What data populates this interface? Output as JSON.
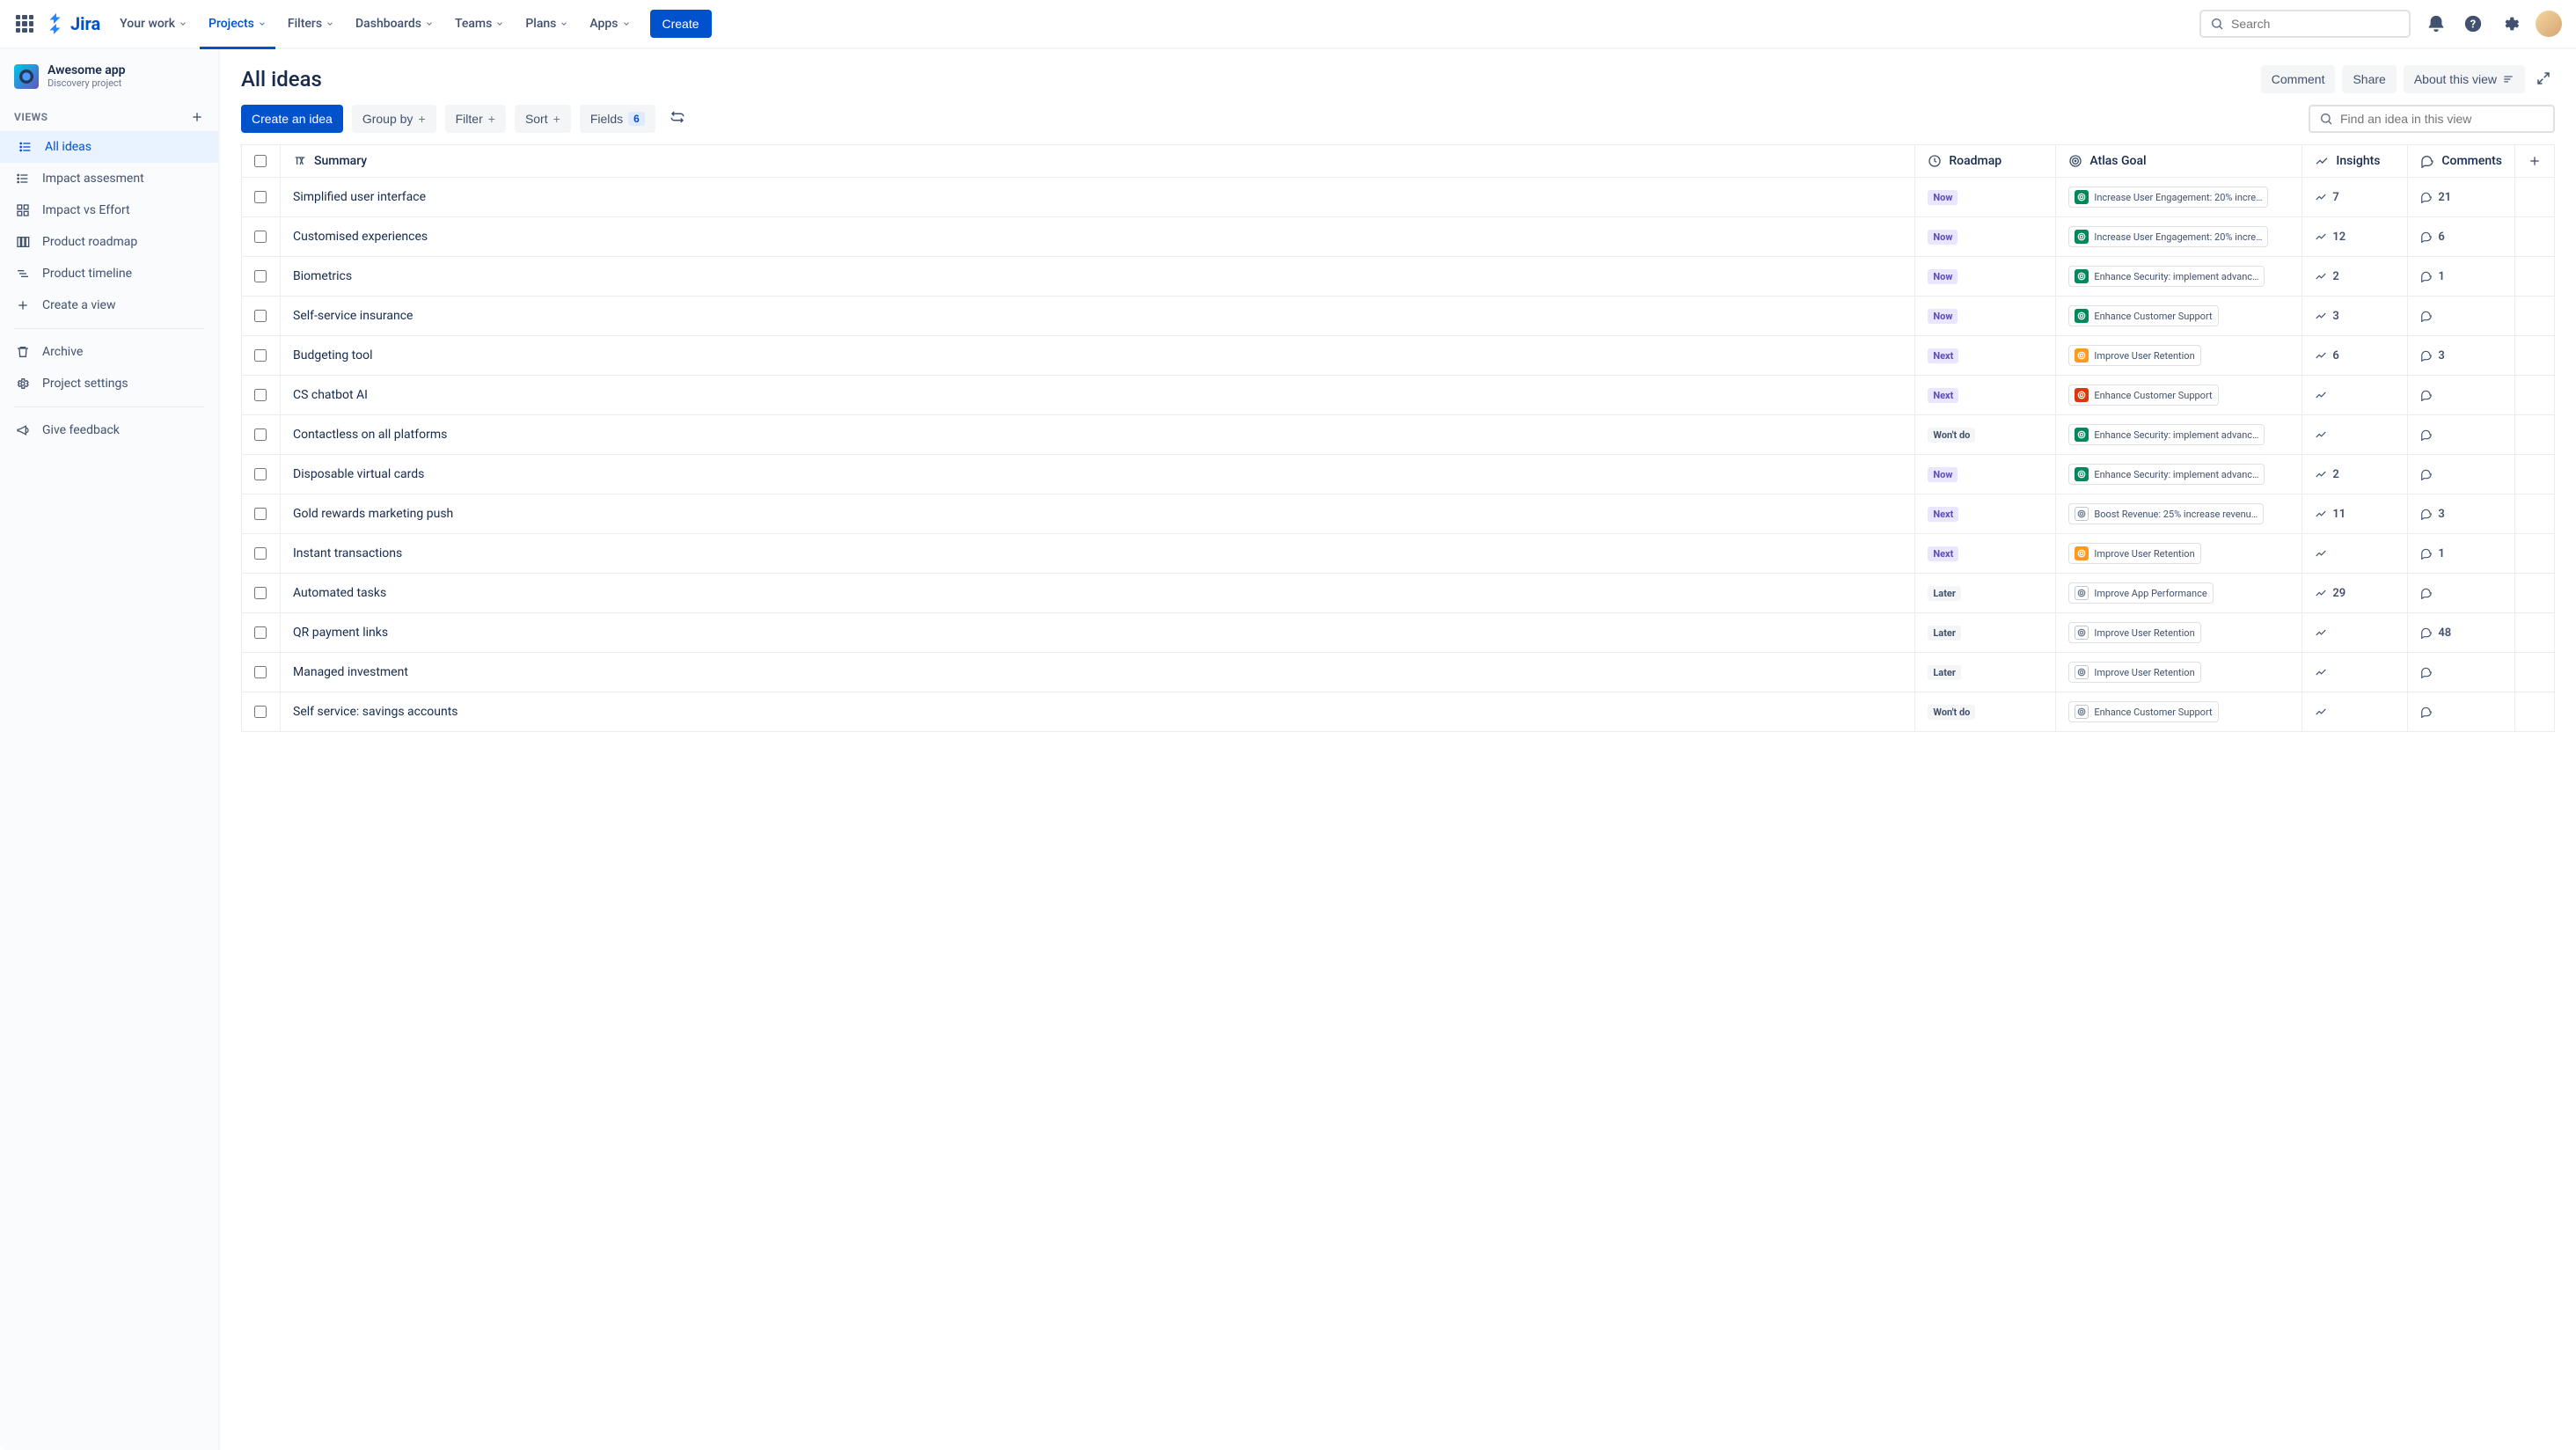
{
  "topnav": {
    "logo": "Jira",
    "items": [
      "Your work",
      "Projects",
      "Filters",
      "Dashboards",
      "Teams",
      "Plans",
      "Apps"
    ],
    "active_index": 1,
    "create": "Create",
    "search_placeholder": "Search"
  },
  "project": {
    "name": "Awesome app",
    "subtitle": "Discovery project"
  },
  "sidebar": {
    "views_label": "VIEWS",
    "items": [
      {
        "label": "All ideas",
        "icon": "list",
        "active": true
      },
      {
        "label": "Impact assesment",
        "icon": "list"
      },
      {
        "label": "Impact vs Effort",
        "icon": "matrix"
      },
      {
        "label": "Product roadmap",
        "icon": "board"
      },
      {
        "label": "Product timeline",
        "icon": "timeline"
      },
      {
        "label": "Create a view",
        "icon": "plus"
      }
    ],
    "archive": "Archive",
    "settings": "Project settings",
    "feedback": "Give feedback"
  },
  "main": {
    "title": "All ideas",
    "header_buttons": {
      "comment": "Comment",
      "share": "Share",
      "about": "About this view"
    },
    "toolbar": {
      "create": "Create an idea",
      "group_by": "Group by",
      "filter": "Filter",
      "sort": "Sort",
      "fields": "Fields",
      "fields_count": "6",
      "find_placeholder": "Find an idea in this view"
    },
    "columns": {
      "summary": "Summary",
      "roadmap": "Roadmap",
      "goal": "Atlas Goal",
      "insights": "Insights",
      "comments": "Comments"
    },
    "rows": [
      {
        "summary": "Simplified user interface",
        "roadmap": "Now",
        "goal": "Increase User Engagement: 20% incre…",
        "goal_status": "green",
        "insights": "7",
        "comments": "21"
      },
      {
        "summary": "Customised experiences",
        "roadmap": "Now",
        "goal": "Increase User Engagement: 20% incre…",
        "goal_status": "green",
        "insights": "12",
        "comments": "6"
      },
      {
        "summary": "Biometrics",
        "roadmap": "Now",
        "goal": "Enhance Security: implement advanc…",
        "goal_status": "green",
        "insights": "2",
        "comments": "1"
      },
      {
        "summary": "Self-service insurance",
        "roadmap": "Now",
        "goal": "Enhance Customer Support",
        "goal_status": "green",
        "insights": "3",
        "comments": ""
      },
      {
        "summary": "Budgeting tool",
        "roadmap": "Next",
        "goal": "Improve User Retention",
        "goal_status": "orange",
        "insights": "6",
        "comments": "3"
      },
      {
        "summary": "CS chatbot AI",
        "roadmap": "Next",
        "goal": "Enhance Customer Support",
        "goal_status": "red",
        "insights": "",
        "comments": ""
      },
      {
        "summary": "Contactless on all platforms",
        "roadmap": "Won't do",
        "goal": "Enhance Security: implement advanc…",
        "goal_status": "green",
        "insights": "",
        "comments": ""
      },
      {
        "summary": "Disposable virtual cards",
        "roadmap": "Now",
        "goal": "Enhance Security: implement advanc…",
        "goal_status": "green",
        "insights": "2",
        "comments": ""
      },
      {
        "summary": "Gold rewards marketing push",
        "roadmap": "Next",
        "goal": "Boost Revenue: 25% increase revenu…",
        "goal_status": "gray",
        "insights": "11",
        "comments": "3"
      },
      {
        "summary": "Instant transactions",
        "roadmap": "Next",
        "goal": "Improve User Retention",
        "goal_status": "orange",
        "insights": "",
        "comments": "1"
      },
      {
        "summary": "Automated tasks",
        "roadmap": "Later",
        "goal": "Improve App Performance",
        "goal_status": "gray",
        "insights": "29",
        "comments": ""
      },
      {
        "summary": "QR payment links",
        "roadmap": "Later",
        "goal": "Improve User Retention",
        "goal_status": "gray",
        "insights": "",
        "comments": "48"
      },
      {
        "summary": "Managed investment",
        "roadmap": "Later",
        "goal": "Improve User Retention",
        "goal_status": "gray",
        "insights": "",
        "comments": ""
      },
      {
        "summary": "Self service: savings accounts",
        "roadmap": "Won't do",
        "goal": "Enhance Customer Support",
        "goal_status": "gray",
        "insights": "",
        "comments": ""
      }
    ]
  }
}
